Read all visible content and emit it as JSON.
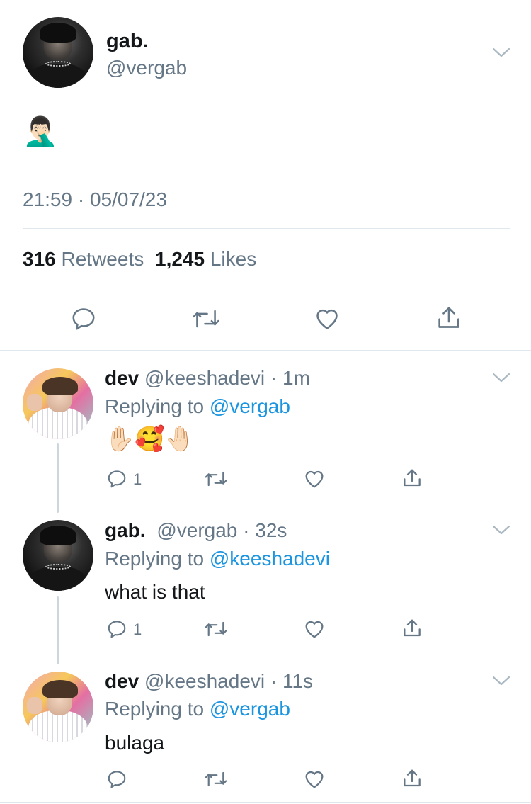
{
  "main_tweet": {
    "author_name": "gab.",
    "author_handle": "@vergab",
    "content_emoji": "🤦🏻‍♂️",
    "timestamp": "21:59 · 05/07/23",
    "retweets_count": "316",
    "retweets_label": "Retweets",
    "likes_count": "1,245",
    "likes_label": "Likes"
  },
  "replies": [
    {
      "name": "dev",
      "handle": "@keeshadevi",
      "time": "· 1m",
      "replying_prefix": "Replying to",
      "replying_to": "@vergab",
      "text": "✋🏻🥰🤚🏻",
      "reply_count": "1"
    },
    {
      "name": "gab.",
      "handle": "@vergab",
      "time": "· 32s",
      "replying_prefix": "Replying to",
      "replying_to": "@keeshadevi",
      "text": "what is that",
      "reply_count": "1"
    },
    {
      "name": "dev",
      "handle": "@keeshadevi",
      "time": "· 11s",
      "replying_prefix": "Replying to",
      "replying_to": "@vergab",
      "text": "bulaga",
      "reply_count": ""
    }
  ],
  "icons": {
    "reply": "reply-icon",
    "retweet": "retweet-icon",
    "like": "heart-icon",
    "share": "share-icon",
    "more": "chevron-down-icon"
  },
  "colors": {
    "text": "#14171a",
    "secondary": "#657786",
    "link": "#1b95e0",
    "divider": "#e1e8ed",
    "thread_line": "#ccd6dd"
  }
}
